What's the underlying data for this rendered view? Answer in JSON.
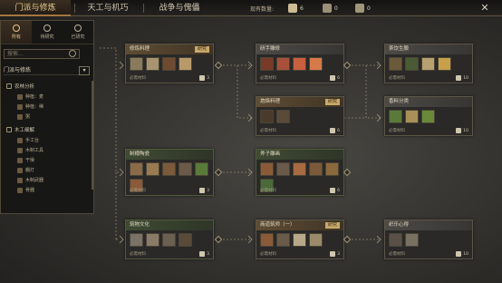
{
  "tabs": [
    {
      "label": "门派与修炼",
      "active": true
    },
    {
      "label": "天工与机巧",
      "active": false
    },
    {
      "label": "战争与傀儡",
      "active": false
    }
  ],
  "resources": {
    "label": "现有数量:",
    "items": [
      {
        "name": "scroll",
        "value": "6",
        "color": "#cdbb94"
      },
      {
        "name": "book",
        "value": "0",
        "color": "#9a8f78"
      },
      {
        "name": "tablet",
        "value": "0",
        "color": "#a0967a"
      }
    ]
  },
  "close_label": "✕",
  "panel": {
    "tabs": [
      {
        "label": "所有"
      },
      {
        "label": "待研究"
      },
      {
        "label": "已研究"
      }
    ],
    "search_placeholder": "搜索...",
    "category": "门派与修炼",
    "category_toggle": "▾",
    "groups": [
      {
        "label": "农林分析",
        "items": [
          "种植：麦",
          "种植：稀",
          "粥"
        ]
      },
      {
        "label": "木工细解",
        "items": [
          "手工台",
          "木制工具",
          "干燥",
          "棚灯",
          "木制武器",
          "骨器"
        ]
      }
    ]
  },
  "tree": {
    "nodes": [
      {
        "id": "n1",
        "title": "修炼料理",
        "tag": "研究",
        "style": "b",
        "icon_colors": [
          "#8a7a5d",
          "#a89470",
          "#6e4a30",
          "#b89a6a"
        ],
        "footer": "必需材料",
        "count": "3"
      },
      {
        "id": "n2",
        "title": "研手雕修",
        "tag": "",
        "style": "s",
        "icon_colors": [
          "#7a3a28",
          "#a8503a",
          "#c9603f",
          "#d77a4a"
        ],
        "footer": "必需材料",
        "count": "6"
      },
      {
        "id": "n3",
        "title": "茶饮生酿",
        "tag": "",
        "style": "s",
        "icon_colors": [
          "#6b5a3a",
          "#4a5a33",
          "#b8a070",
          "#c8a04a"
        ],
        "footer": "必需材料",
        "count": "10"
      },
      {
        "id": "n4",
        "title": "炮烙料理",
        "tag": "研究",
        "style": "b",
        "icon_colors": [
          "#4a3a2a",
          "#5a4a3a"
        ],
        "footer": "必需材料",
        "count": "6"
      },
      {
        "id": "n5",
        "title": "香料分类",
        "tag": "",
        "style": "s",
        "icon_colors": [
          "#5a7a3a",
          "#a89058",
          "#6a8a3a"
        ],
        "footer": "必需材料",
        "count": "10"
      },
      {
        "id": "n6",
        "title": "制樽陶瓷",
        "tag": "",
        "style": "g",
        "icon_colors": [
          "#8a6a48",
          "#9a7a50",
          "#7a5a3a",
          "#6a5a48",
          "#5a7a3a",
          "#8a5a3a"
        ],
        "footer": "必需材料",
        "count": "3"
      },
      {
        "id": "n7",
        "title": "斧子雕画",
        "tag": "",
        "style": "g",
        "icon_colors": [
          "#8a5a38",
          "#6a5a4a",
          "#a86a40",
          "#7a5a3a",
          "#8a6a3a",
          "#4a6a3a"
        ],
        "footer": "必需材料",
        "count": "6"
      },
      {
        "id": "n8",
        "title": "筑物文化",
        "tag": "",
        "style": "g",
        "icon_colors": [
          "#7a7268",
          "#8a7a68",
          "#6a6052",
          "#5a4a3a"
        ],
        "footer": "必需材料",
        "count": "3"
      },
      {
        "id": "n9",
        "title": "商道筑师（一）",
        "tag": "研究",
        "style": "b",
        "icon_colors": [
          "#8a5a38",
          "#6a5a4a",
          "#b8a88a",
          "#9a8a6a"
        ],
        "footer": "必需材料",
        "count": "3"
      },
      {
        "id": "n10",
        "title": "织乐心得",
        "tag": "",
        "style": "s",
        "icon_colors": [
          "#5a5048",
          "#7a7060"
        ],
        "footer": "必需材料",
        "count": "10"
      }
    ]
  }
}
